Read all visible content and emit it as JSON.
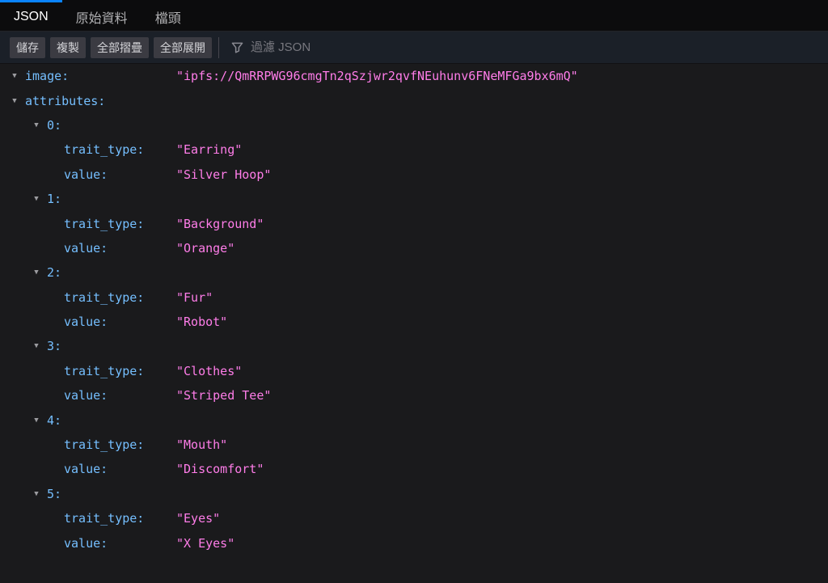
{
  "tabs": {
    "json": "JSON",
    "raw_data": "原始資料",
    "headers": "檔頭"
  },
  "toolbar": {
    "save": "儲存",
    "copy": "複製",
    "collapse_all": "全部摺疊",
    "expand_all": "全部展開",
    "filter_placeholder": "過濾 JSON"
  },
  "icons": {
    "collapse_arrow": "▼",
    "funnel": "funnel-filter-icon"
  },
  "colors": {
    "accent_blue": "#0a84ff",
    "key_blue": "#75bfff",
    "string_pink": "#ff7de9",
    "tabbar_bg": "#0c0c0d",
    "toolbar_bg": "#1b2028",
    "content_bg": "#1a1a1c",
    "button_bg": "#3b3b42"
  },
  "rows": [
    {
      "key": "image:",
      "value": "\"ipfs://QmRRPWG96cmgTn2qSzjwr2qvfNEuhunv6FNeMFGa9bx6mQ\""
    },
    {
      "key": "attributes:",
      "value": ""
    },
    {
      "key": "0:",
      "value": ""
    },
    {
      "key": "trait_type:",
      "value": "\"Earring\""
    },
    {
      "key": "value:",
      "value": "\"Silver Hoop\""
    },
    {
      "key": "1:",
      "value": ""
    },
    {
      "key": "trait_type:",
      "value": "\"Background\""
    },
    {
      "key": "value:",
      "value": "\"Orange\""
    },
    {
      "key": "2:",
      "value": ""
    },
    {
      "key": "trait_type:",
      "value": "\"Fur\""
    },
    {
      "key": "value:",
      "value": "\"Robot\""
    },
    {
      "key": "3:",
      "value": ""
    },
    {
      "key": "trait_type:",
      "value": "\"Clothes\""
    },
    {
      "key": "value:",
      "value": "\"Striped Tee\""
    },
    {
      "key": "4:",
      "value": ""
    },
    {
      "key": "trait_type:",
      "value": "\"Mouth\""
    },
    {
      "key": "value:",
      "value": "\"Discomfort\""
    },
    {
      "key": "5:",
      "value": ""
    },
    {
      "key": "trait_type:",
      "value": "\"Eyes\""
    },
    {
      "key": "value:",
      "value": "\"X Eyes\""
    }
  ]
}
